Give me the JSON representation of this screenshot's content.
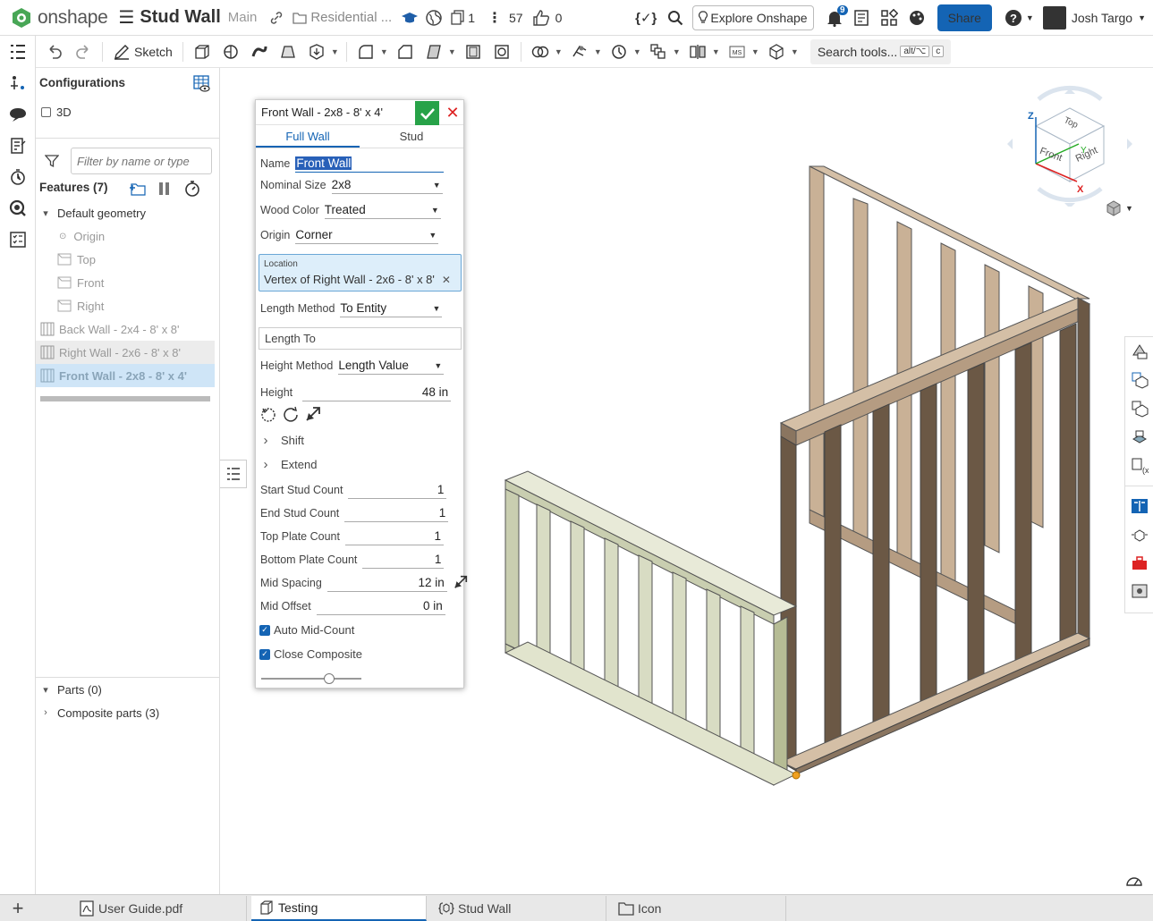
{
  "header": {
    "brand": "onshape",
    "doc_title": "Stud Wall",
    "branch": "Main",
    "folder": "Residential ...",
    "version_count": "1",
    "feature_count": "57",
    "like_count": "0",
    "explore_label": "Explore Onshape",
    "notification_count": "9",
    "share_label": "Share",
    "user_name": "Josh Targo",
    "colors": {
      "share": "#1464b4",
      "accent": "#1464b4",
      "ok": "#27a248",
      "logo": "#48a656"
    }
  },
  "toolbar": {
    "sketch_label": "Sketch",
    "search_label": "Search tools...",
    "shortcut_1": "alt/⌥",
    "shortcut_2": "c"
  },
  "feature_panel": {
    "configurations_label": "Configurations",
    "config_option": "3D",
    "filter_placeholder": "Filter by name or type",
    "features_label": "Features (7)",
    "default_geometry_label": "Default geometry",
    "default_items": [
      "Origin",
      "Top",
      "Front",
      "Right"
    ],
    "features": [
      "Back Wall - 2x4 - 8' x 8'",
      "Right Wall - 2x6 - 8' x 8'",
      "Front Wall - 2x8 - 8' x 4'"
    ],
    "parts_label": "Parts (0)",
    "composite_label": "Composite parts (3)"
  },
  "dialog": {
    "title": "Front Wall - 2x8 - 8' x 4'",
    "tabs": [
      "Full Wall",
      "Stud"
    ],
    "name_label": "Name",
    "name_value": "Front Wall",
    "nominal_size_label": "Nominal Size",
    "nominal_size_value": "2x8",
    "wood_color_label": "Wood Color",
    "wood_color_value": "Treated",
    "origin_label": "Origin",
    "origin_value": "Corner",
    "location_label": "Location",
    "location_value": "Vertex of Right Wall - 2x6 - 8' x 8'",
    "length_method_label": "Length Method",
    "length_method_value": "To Entity",
    "length_to_label": "Length To",
    "height_method_label": "Height Method",
    "height_method_value": "Length Value",
    "height_label": "Height",
    "height_value": "48 in",
    "shift_label": "Shift",
    "extend_label": "Extend",
    "start_stud_label": "Start Stud Count",
    "start_stud_value": "1",
    "end_stud_label": "End Stud Count",
    "end_stud_value": "1",
    "top_plate_label": "Top Plate Count",
    "top_plate_value": "1",
    "bottom_plate_label": "Bottom Plate Count",
    "bottom_plate_value": "1",
    "mid_spacing_label": "Mid Spacing",
    "mid_spacing_value": "12 in",
    "mid_offset_label": "Mid Offset",
    "mid_offset_value": "0 in",
    "auto_mid_label": "Auto Mid-Count",
    "close_composite_label": "Close Composite",
    "slider_value": 0.7
  },
  "viewcube": {
    "top": "Top",
    "front": "Front",
    "right": "Right",
    "axis_z": "Z",
    "axis_x": "X",
    "axis_y": "Y"
  },
  "bottom_tabs": [
    "User Guide.pdf",
    "Testing",
    "Stud Wall",
    "Icon"
  ]
}
